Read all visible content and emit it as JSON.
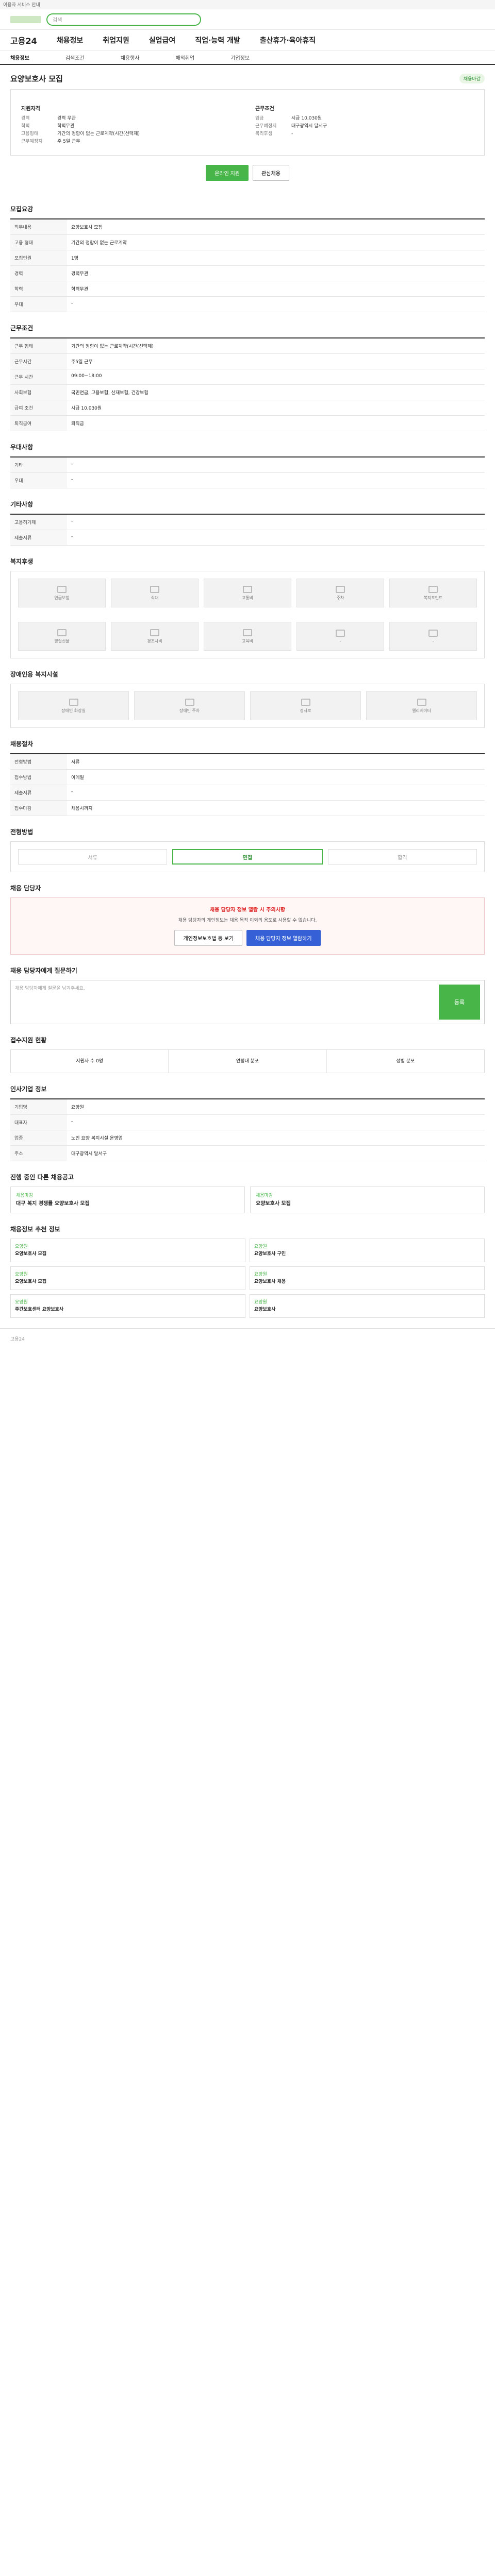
{
  "topbar": {
    "notice": "이용자 서비스 안내"
  },
  "header": {
    "search_placeholder": "검색"
  },
  "gnb": {
    "brand": "고용24",
    "items": [
      "채용정보",
      "취업지원",
      "실업급여",
      "직업·능력 개발",
      "출산휴가·육아휴직"
    ]
  },
  "subnav": [
    "채용정보",
    "검색조건",
    "채용행사",
    "해외취업",
    "기업정보"
  ],
  "job": {
    "title": "요양보호사 모집",
    "badge": "채용마감",
    "left_label": "지원자격",
    "left_rows": [
      [
        "경력",
        "경력 무관"
      ],
      [
        "학력",
        "학력무관"
      ],
      [
        "고용형태",
        "기간의 정함이 없는 근로계약(시간(선택제)"
      ],
      [
        "근무예정지",
        "주 5일 근무"
      ]
    ],
    "right_label": "근무조건",
    "right_rows": [
      [
        "임금",
        "시급 10,030원"
      ],
      [
        "근무예정지",
        "대구광역시 달서구"
      ],
      [
        "복리후생",
        "-"
      ]
    ]
  },
  "buttons": {
    "apply": "온라인 지원",
    "scrap": "관심채용"
  },
  "sections": {
    "recruit": "모집요강",
    "work": "근무조건",
    "etc": "우대사항",
    "other": "기타사항",
    "welfare": "복지후생",
    "disabled": "장애인용 복지시설",
    "process": "채용절차",
    "select": "전형방법",
    "contact": "채용 담당자",
    "question": "채용 담당자에게 질문하기",
    "status": "접수지원 현황",
    "company": "인사기업 정보",
    "orginfo": "기업정보",
    "others": "진행 중인 다른 채용공고",
    "similar": "채용정보 추천 정보"
  },
  "recruit_rows": [
    [
      "직무내용",
      "요양보호사 모집"
    ],
    [
      "고용 형태",
      "기간의 정함이 없는 근로계약"
    ],
    [
      "모집인원",
      "1명"
    ],
    [
      "경력",
      "경력무관"
    ],
    [
      "학력",
      "학력무관"
    ],
    [
      "우대",
      "-"
    ]
  ],
  "work_rows": [
    [
      "근무 형태",
      "기간의 정함이 없는 근로계약(시간(선택제)"
    ],
    [
      "근무시간",
      "주5일 근무"
    ],
    [
      "근무 시간",
      "09:00~18:00"
    ],
    [
      "사회보험",
      "국민연금, 고용보험, 산재보험, 건강보험"
    ],
    [
      "급여 조건",
      "시급 10,030원"
    ],
    [
      "퇴직급여",
      "퇴직금"
    ]
  ],
  "etc_rows": [
    [
      "기타",
      "-"
    ],
    [
      "우대",
      "-"
    ]
  ],
  "other_rows": [
    [
      "고용허가제",
      "-"
    ],
    [
      "제출서류",
      "-"
    ]
  ],
  "welfare_items": [
    "연금보험",
    "식대",
    "교통비",
    "주차",
    "복지포인트",
    "명절선물",
    "경조사비",
    "교육비",
    "-",
    "-"
  ],
  "disabled_items": [
    "장애인 화장실",
    "장애인 주차",
    "경사로",
    "엘리베이터"
  ],
  "process_rows": [
    [
      "전형방법",
      "서류"
    ],
    [
      "접수방법",
      "이메일"
    ],
    [
      "제출서류",
      "-"
    ],
    [
      "접수마감",
      "채용시까지"
    ]
  ],
  "steps": [
    "서류",
    "면접",
    "합격"
  ],
  "alert": {
    "h": "채용 담당자 정보 열람 시 주의사항",
    "body": "채용 담당자의 개인정보는 채용 목적 이외의 용도로 사용할 수 없습니다.",
    "btn1": "개인정보보호법 등 보기",
    "btn2": "채용 담당자 정보 열람하기"
  },
  "question": {
    "placeholder": "채용 담당자에게 질문을 남겨주세요.",
    "send": "등록"
  },
  "status": [
    "지원자 수 0명",
    "연령대 분포",
    "성별 분포"
  ],
  "company_rows": [
    [
      "기업명",
      "요양원"
    ],
    [
      "대표자",
      "-"
    ],
    [
      "업종",
      "노인 요양 복지시설 운영업"
    ],
    [
      "주소",
      "대구광역시 달서구"
    ]
  ],
  "others": [
    {
      "org": "채용마감",
      "title": "대구 복지 경쟁률 요양보호사 모집"
    },
    {
      "org": "채용마감",
      "title": "요양보호사 모집"
    }
  ],
  "similar": [
    {
      "org": "요양원",
      "title": "요양보호사 모집"
    },
    {
      "org": "요양원",
      "title": "요양보호사 구인"
    },
    {
      "org": "요양원",
      "title": "요양보호사 모집"
    },
    {
      "org": "요양원",
      "title": "요양보호사 채용"
    },
    {
      "org": "요양원",
      "title": "주간보호센터 요양보호사"
    },
    {
      "org": "요양원",
      "title": "요양보호사"
    }
  ],
  "footer": "고용24"
}
